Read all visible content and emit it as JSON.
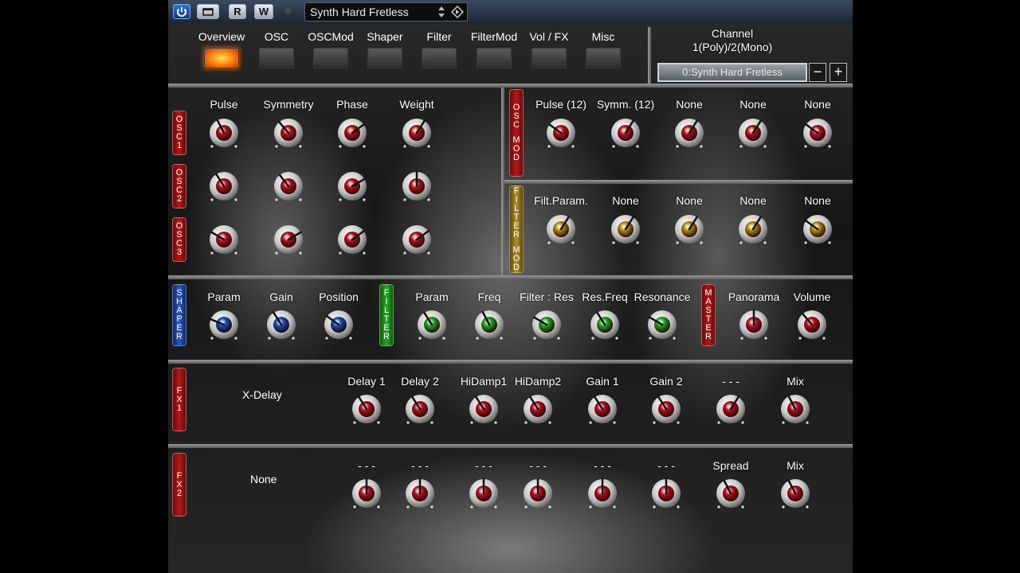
{
  "topbar": {
    "power_label": "",
    "r_label": "R",
    "w_label": "W",
    "preset_name": "Synth Hard Fretless"
  },
  "nav": {
    "tabs": [
      "Overview",
      "OSC",
      "OSCMod",
      "Shaper",
      "Filter",
      "FilterMod",
      "Vol / FX",
      "Misc"
    ],
    "active_tab": "Overview"
  },
  "channel": {
    "title": "Channel",
    "mode": "1(Poly)/2(Mono)",
    "selected": "0:Synth Hard Fretless",
    "minus_label": "−",
    "plus_label": "+"
  },
  "osc": {
    "columns": [
      "Pulse",
      "Symmetry",
      "Phase",
      "Weight"
    ],
    "rows": [
      {
        "tag": [
          "O",
          "S",
          "C",
          "1"
        ],
        "values": [
          0.4,
          0.35,
          0.7,
          0.62
        ]
      },
      {
        "tag": [
          "O",
          "S",
          "C",
          "2"
        ],
        "values": [
          0.38,
          0.36,
          0.72,
          0.5
        ]
      },
      {
        "tag": [
          "O",
          "S",
          "C",
          "3"
        ],
        "values": [
          0.28,
          0.72,
          0.7,
          0.7
        ]
      }
    ]
  },
  "osc_mod": {
    "tag": [
      "O",
      "S",
      "C",
      "M",
      "O",
      "D"
    ],
    "labels": [
      "Pulse (12)",
      "Symm. (12)",
      "None",
      "None",
      "None"
    ],
    "values": [
      0.3,
      0.62,
      0.62,
      0.62,
      0.3
    ]
  },
  "filter_mod": {
    "tag": [
      "F",
      "I",
      "L",
      "T",
      "E",
      "R",
      "M",
      "O",
      "D"
    ],
    "labels": [
      "Filt.Param.",
      "None",
      "None",
      "None",
      "None"
    ],
    "values": [
      0.62,
      0.62,
      0.62,
      0.62,
      0.3
    ]
  },
  "shaper": {
    "tag": [
      "S",
      "H",
      "A",
      "P",
      "E",
      "R"
    ],
    "labels": [
      "Param",
      "Gain",
      "Position"
    ],
    "values": [
      0.25,
      0.38,
      0.3
    ]
  },
  "filter": {
    "tag": [
      "F",
      "I",
      "L",
      "T",
      "E",
      "R"
    ],
    "labels": [
      "Param",
      "Freq",
      "Filter : Res",
      "Res.Freq",
      "Resonance"
    ],
    "values": [
      0.38,
      0.4,
      0.28,
      0.38,
      0.28
    ]
  },
  "master": {
    "tag": [
      "M",
      "A",
      "S",
      "T",
      "E",
      "R"
    ],
    "labels": [
      "Panorama",
      "Volume"
    ],
    "values": [
      0.5,
      0.35
    ]
  },
  "fx1": {
    "tag": [
      "F",
      "X",
      "1"
    ],
    "name": "X-Delay",
    "labels": [
      "Delay 1",
      "Delay 2",
      "HiDamp1",
      "HiDamp2",
      "Gain 1",
      "Gain 2",
      "- - -",
      "Mix"
    ],
    "values": [
      0.38,
      0.38,
      0.38,
      0.38,
      0.38,
      0.38,
      0.62,
      0.4
    ]
  },
  "fx2": {
    "tag": [
      "F",
      "X",
      "2"
    ],
    "name": "None",
    "labels": [
      "- - -",
      "- - -",
      "- - -",
      "- - -",
      "- - -",
      "- - -",
      "Spread",
      "Mix"
    ],
    "values": [
      0.5,
      0.5,
      0.5,
      0.5,
      0.5,
      0.5,
      0.4,
      0.4
    ]
  },
  "colors": {
    "knob_red": "#b01020",
    "knob_gold": "#b08a10",
    "knob_blue": "#1a4ab0",
    "knob_green": "#20a020",
    "nav_active": "#ff8a10"
  },
  "icons": {
    "power": "power-icon",
    "toggle": "window-toggle-icon",
    "preset_arrows": "up-down-arrows-icon",
    "preset_menu": "diamond-menu-icon"
  }
}
